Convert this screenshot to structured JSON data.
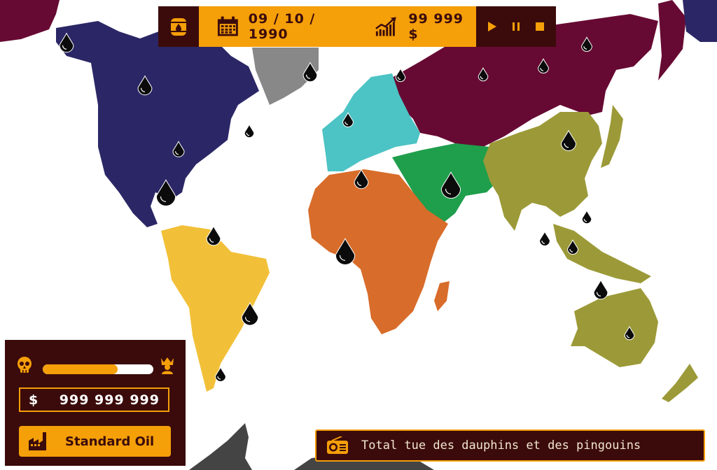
{
  "topbar": {
    "date": "09 / 10 / 1990",
    "balance": "99 999 $",
    "icons": [
      "oil-barrel-icon",
      "calendar-icon",
      "chart-growth-icon",
      "play-icon",
      "pause-icon",
      "stop-icon"
    ]
  },
  "status_panel": {
    "reputation_fraction": 0.68,
    "left_icon": "skull-icon",
    "right_icon": "crown-king-icon",
    "currency_symbol": "$",
    "money": "999 999 999",
    "company_icon": "factory-icon",
    "company_name": "Standard Oil"
  },
  "news": {
    "icon": "radio-icon",
    "text": "Total tue des dauphins et des pingouins"
  },
  "colors": {
    "accent_orange": "#f59f09",
    "panel_brown": "#3b0b0b",
    "north_america": "#2b2766",
    "south_america": "#f2c038",
    "europe": "#4cc3c4",
    "africa": "#d86c2a",
    "middle_east": "#1f9e4c",
    "russia": "#670a33",
    "asia_oceania": "#9c9a38",
    "greenland": "#888888",
    "antarctica": "#444444"
  },
  "oil_deposits_count": 24
}
